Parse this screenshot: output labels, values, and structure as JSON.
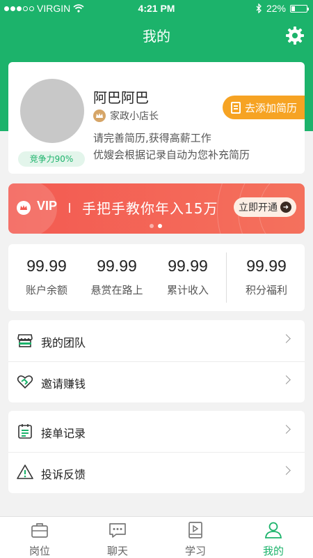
{
  "status_bar": {
    "carrier": "VIRGIN",
    "time": "4:21 PM",
    "battery": "22%"
  },
  "header": {
    "title": "我的"
  },
  "profile": {
    "name": "阿巴阿巴",
    "role": "家政小店长",
    "desc_line1": "请完善简历,获得高薪工作",
    "desc_line2": "优嫂会根据记录自动为您补充简历",
    "compete": "竞争力90%",
    "add_resume": "去添加简历"
  },
  "vip_banner": {
    "badge": "VIP",
    "slogan": "手把手教你年入15万",
    "button": "立即开通"
  },
  "stats": [
    {
      "value": "99.99",
      "label": "账户余额"
    },
    {
      "value": "99.99",
      "label": "悬赏在路上"
    },
    {
      "value": "99.99",
      "label": "累计收入"
    },
    {
      "value": "99.99",
      "label": "积分福利"
    }
  ],
  "menu_group1": [
    {
      "label": "我的团队",
      "icon": "store-icon"
    },
    {
      "label": "邀请赚钱",
      "icon": "handshake-heart-icon"
    }
  ],
  "menu_group2": [
    {
      "label": "接单记录",
      "icon": "calendar-list-icon"
    },
    {
      "label": "投诉反馈",
      "icon": "warning-icon"
    }
  ],
  "tabs": [
    {
      "label": "岗位",
      "icon": "briefcase-icon"
    },
    {
      "label": "聊天",
      "icon": "chat-icon"
    },
    {
      "label": "学习",
      "icon": "book-icon"
    },
    {
      "label": "我的",
      "icon": "user-icon"
    }
  ],
  "colors": {
    "brand_green": "#1cb36b",
    "vip_red": "#f35a51",
    "resume_orange": "#f6a323"
  }
}
